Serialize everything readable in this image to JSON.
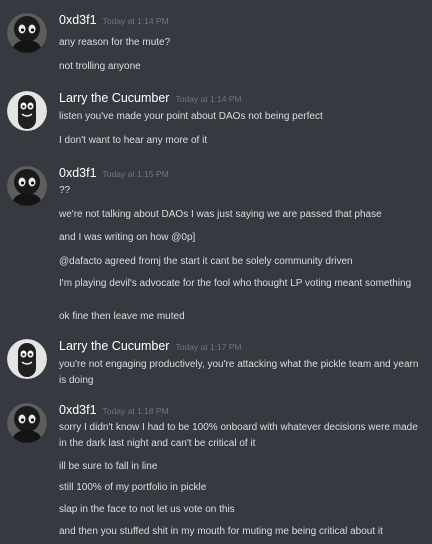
{
  "groups": [
    {
      "author": "0xd3f1",
      "avatar_icon": "dark-character-avatar-icon",
      "timestamp": "Today at 1:14 PM",
      "messages": [
        "any reason for the mute?",
        "not trolling anyone"
      ]
    },
    {
      "author": "Larry the Cucumber",
      "avatar_icon": "cucumber-avatar-icon",
      "timestamp": "Today at 1:14 PM",
      "messages": [
        "listen you've made your point about DAOs not being perfect",
        "I don't want to hear any more of it"
      ]
    },
    {
      "author": "0xd3f1",
      "avatar_icon": "dark-character-avatar-icon",
      "timestamp": "Today at 1:15 PM",
      "messages": [
        "??",
        "we're not talking about DAOs I was just saying we are passed that phase",
        "and I was writing on how @0p]",
        "@dafacto agreed fromj the start it cant be solely community driven",
        "I'm playing devil's advocate for the fool who thought LP voting meant something",
        "ok fine then leave me muted"
      ]
    },
    {
      "author": "Larry the Cucumber",
      "avatar_icon": "cucumber-avatar-icon",
      "timestamp": "Today at 1:17 PM",
      "messages": [
        "you're not engaging productively, you're attacking what the pickle team and yearn is doing"
      ]
    },
    {
      "author": "0xd3f1",
      "avatar_icon": "dark-character-avatar-icon",
      "timestamp": "Today at 1:18 PM",
      "messages": [
        "sorry I didn't know I had to be 100% onboard with whatever decisions were made in the dark last night and can't be critical of it",
        "ill be sure to fall in line",
        "still 100% of my portfolio in pickle",
        "slap in the face to not let us vote on this",
        "and then you stuffed shit in my mouth for muting me being critical about it"
      ]
    }
  ]
}
